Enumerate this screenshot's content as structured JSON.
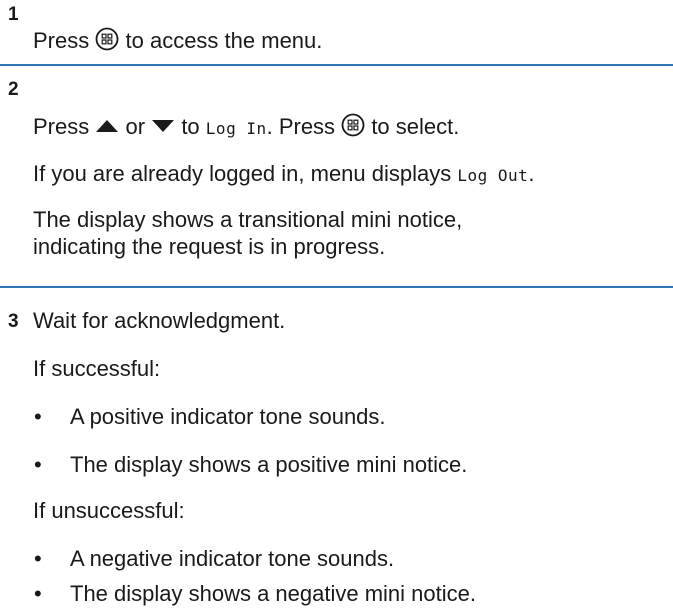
{
  "steps": [
    {
      "number": "1",
      "line1": {
        "before": "Press",
        "after": "to access the menu."
      }
    },
    {
      "number": "2",
      "line1": {
        "press": "Press",
        "or": "or",
        "to": "to",
        "code": "Log In",
        "period_press": ". Press",
        "to_select": "to select."
      },
      "line2": {
        "before": "If you are already logged in, menu displays",
        "code": "Log Out",
        "after": "."
      },
      "line3": "The display shows a transitional mini notice,",
      "line4": "indicating the request is in progress."
    },
    {
      "number": "3",
      "line1": "Wait for acknowledgment.",
      "success_label": "If successful:",
      "success_items": [
        "A positive indicator tone sounds.",
        "The display shows a positive mini notice."
      ],
      "fail_label": "If unsuccessful:",
      "fail_items": [
        "A negative indicator tone sounds.",
        "The display shows a negative mini notice."
      ]
    }
  ],
  "icons": {
    "menu": "menu-ok-button-icon",
    "up": "up-arrow-icon",
    "down": "down-arrow-icon"
  },
  "colors": {
    "divider": "#2f75b5",
    "text": "#1a1a1a"
  }
}
